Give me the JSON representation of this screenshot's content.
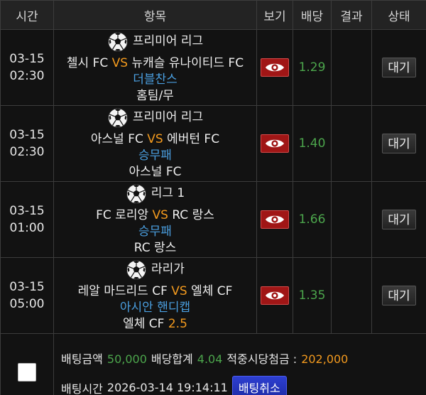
{
  "header": {
    "time": "시간",
    "item": "항목",
    "view": "보기",
    "odds": "배당",
    "result": "결과",
    "status": "상태"
  },
  "rows": [
    {
      "date": "03-15",
      "clock": "02:30",
      "league": "프리미어 리그",
      "home": "첼시 FC",
      "vs": "VS",
      "away": "뉴캐슬 유나이티드 FC",
      "market": "더블찬스",
      "pick": "홈팀/무",
      "pick_odds": "",
      "odds": "1.29",
      "result": "",
      "status": "대기"
    },
    {
      "date": "03-15",
      "clock": "02:30",
      "league": "프리미어 리그",
      "home": "아스널 FC",
      "vs": "VS",
      "away": "에버턴 FC",
      "market": "승무패",
      "pick": "아스널 FC",
      "pick_odds": "",
      "odds": "1.40",
      "result": "",
      "status": "대기"
    },
    {
      "date": "03-15",
      "clock": "01:00",
      "league": "리그 1",
      "home": "FC 로리앙",
      "vs": "VS",
      "away": "RC 랑스",
      "market": "승무패",
      "pick": "RC 랑스",
      "pick_odds": "",
      "odds": "1.66",
      "result": "",
      "status": "대기"
    },
    {
      "date": "03-15",
      "clock": "05:00",
      "league": "라리가",
      "home": "레알 마드리드 CF",
      "vs": "VS",
      "away": "엘체 CF",
      "market": "아시안 핸디캡",
      "pick": "엘체 CF",
      "pick_odds": "2.5",
      "odds": "1.35",
      "result": "",
      "status": "대기"
    }
  ],
  "summary": {
    "bet_amount_label": "배팅금액",
    "bet_amount": "50,000",
    "total_odds_label": "배당합계",
    "total_odds": "4.04",
    "expected_label": "적중시당첨금 :",
    "expected": "202,000",
    "bet_time_label": "배팅시간",
    "bet_time": "2026-03-14 19:14:11",
    "cancel_label": "배팅취소"
  },
  "icons": {
    "league": "soccer-ball-icon",
    "view": "eye-icon"
  },
  "colors": {
    "vs": "#f39a1e",
    "market": "#4a9fe0",
    "odds": "#4ca64c",
    "view_button": "#a01616",
    "cancel_button": "#1d2aa5"
  }
}
